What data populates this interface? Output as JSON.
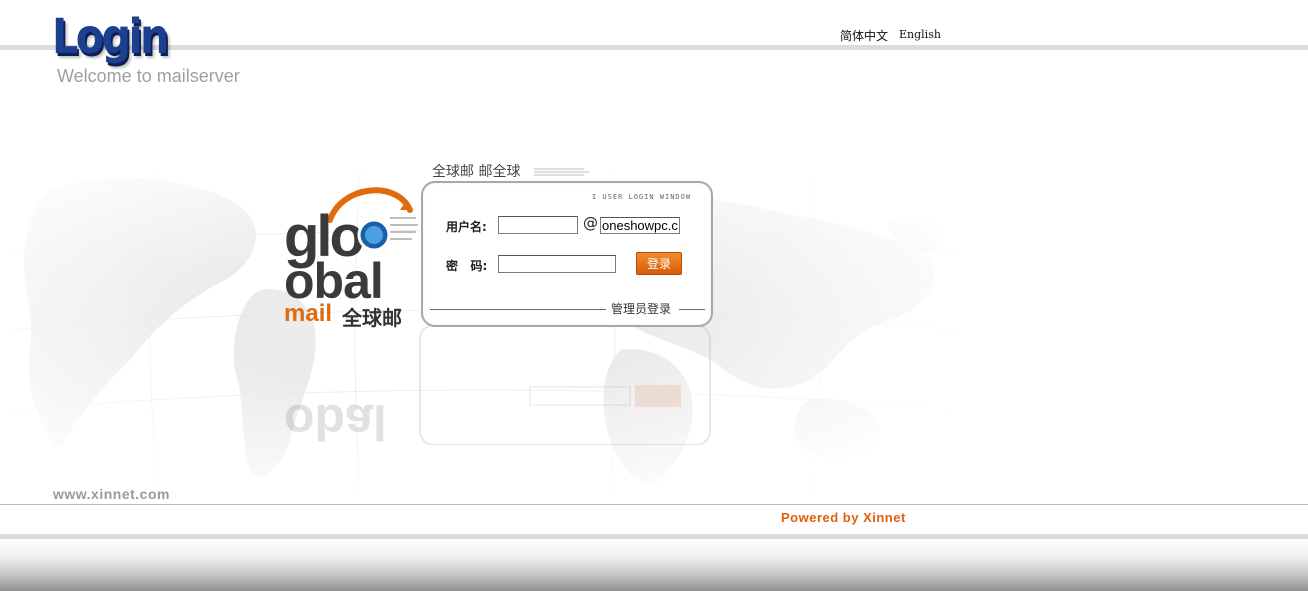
{
  "header": {
    "logo_text": "Login",
    "welcome": "Welcome to mailserver",
    "lang_chinese": "简体中文",
    "lang_english": "English"
  },
  "brand": {
    "mail_word": "mail",
    "mail_cn": "全球邮"
  },
  "panel": {
    "title": "全球邮 邮全球",
    "window_label": "I USER LOGIN WINDOW",
    "username_label": "用户名:",
    "at_sign": "@",
    "domain_value": "oneshowpc.co",
    "password_label": "密   码:",
    "login_button": "登录",
    "admin_login": "管理员登录"
  },
  "footer": {
    "site": "www.xinnet.com",
    "powered": "Powered by Xinnet"
  },
  "colors": {
    "accent_orange": "#e2600c",
    "logo_blue": "#1c3f8f"
  }
}
